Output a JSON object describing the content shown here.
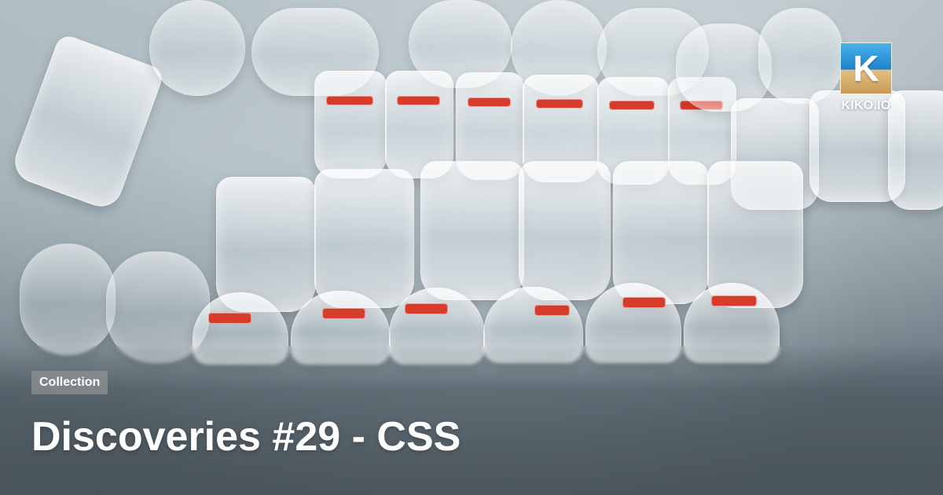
{
  "card": {
    "badge": "Collection",
    "title": "Discoveries #29 - CSS"
  },
  "brand": {
    "logo_letter": "K",
    "name": "KIKO.IO"
  },
  "colors": {
    "badge_bg": "#969696",
    "text": "#ffffff",
    "label_red": "#d73b2a"
  }
}
